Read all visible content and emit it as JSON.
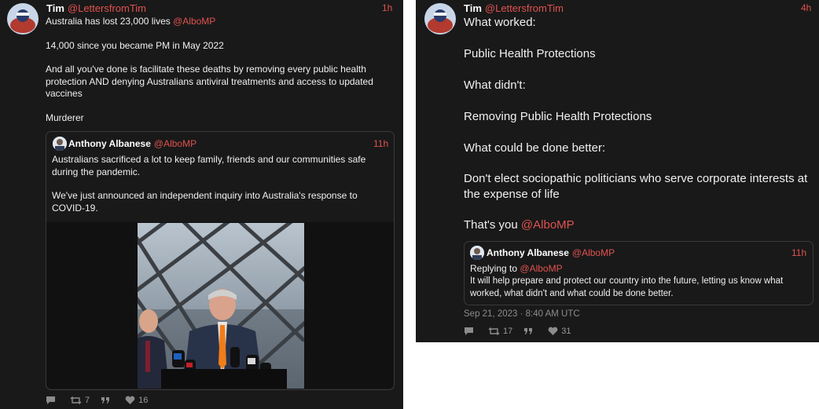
{
  "left_post": {
    "author_name": "Tim",
    "author_handle": "@LettersfromTim",
    "time": "1h",
    "line1": "Australia has lost 23,000 lives",
    "line1_mention": "@AlboMP",
    "line2": "14,000 since you became PM in May 2022",
    "line3": "And all you've done is facilitate these deaths by removing every public health protection AND denying Australians antiviral treatments and access to updated vaccines",
    "line4": "Murderer",
    "quote": {
      "author_name": "Anthony Albanese",
      "author_handle": "@AlboMP",
      "time": "11h",
      "line1": "Australians sacrificed a lot to keep family, friends and our communities safe during the pandemic.",
      "line2": "We've just announced an independent inquiry into Australia's response to COVID-19."
    },
    "replies": "",
    "reposts": "7",
    "quotes": "",
    "likes": "16"
  },
  "right_post": {
    "author_name": "Tim",
    "author_handle": "@LettersfromTim",
    "time": "4h",
    "lines": [
      "What worked:",
      "Public Health Protections",
      "What didn't:",
      "Removing Public Health Protections",
      "What could be done better:",
      "Don't elect sociopathic politicians who serve corporate interests at the expense of life",
      "That's you"
    ],
    "last_mention": "@AlboMP",
    "quote": {
      "author_name": "Anthony Albanese",
      "author_handle": "@AlboMP",
      "time": "11h",
      "replying_prefix": "Replying to",
      "replying_handle": "@AlboMP",
      "text": "It will help prepare and protect our country into the future, letting us know what worked, what didn't and what could be done better."
    },
    "timestamp": "Sep 21, 2023 · 8:40 AM UTC",
    "replies": "",
    "reposts": "17",
    "quotes": "",
    "likes": "31"
  },
  "colors": {
    "background": "#191919",
    "accent": "#e0524f",
    "border": "#3a3a3a"
  },
  "icons": [
    "comment-icon",
    "repost-icon",
    "quote-icon",
    "heart-icon"
  ]
}
